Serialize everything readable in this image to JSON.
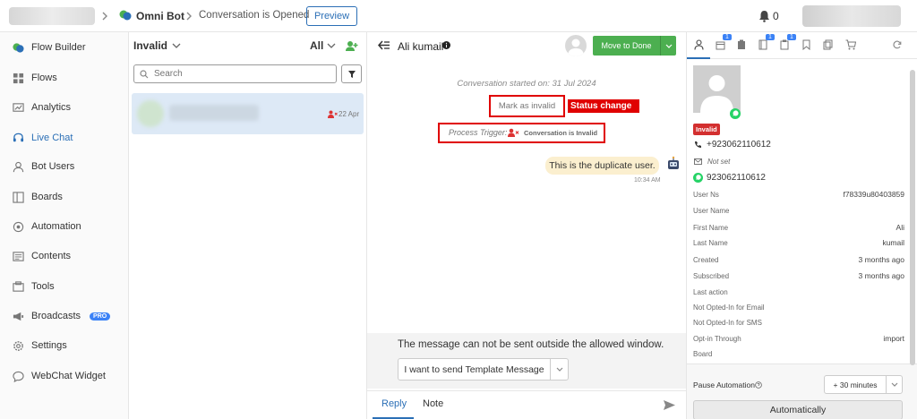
{
  "topbar": {
    "bot_name": "Omni Bot",
    "status": "Conversation is Opened",
    "preview_label": "Preview",
    "notification_count": "0"
  },
  "sidebar": {
    "items": [
      {
        "label": "Flow Builder",
        "icon": "chat-bubbles-icon"
      },
      {
        "label": "Flows",
        "icon": "grid-icon"
      },
      {
        "label": "Analytics",
        "icon": "analytics-icon"
      },
      {
        "label": "Live Chat",
        "icon": "headset-icon"
      },
      {
        "label": "Bot Users",
        "icon": "user-icon"
      },
      {
        "label": "Boards",
        "icon": "board-icon"
      },
      {
        "label": "Automation",
        "icon": "automation-icon"
      },
      {
        "label": "Contents",
        "icon": "contents-icon"
      },
      {
        "label": "Tools",
        "icon": "tools-icon"
      },
      {
        "label": "Broadcasts",
        "icon": "megaphone-icon",
        "badge": "PRO"
      },
      {
        "label": "Settings",
        "icon": "gear-icon"
      },
      {
        "label": "WebChat Widget",
        "icon": "chat-icon"
      }
    ],
    "active": "Live Chat"
  },
  "list": {
    "filter_label": "Invalid",
    "all_label": "All",
    "search_placeholder": "Search",
    "conversation": {
      "date": "22 Apr"
    }
  },
  "chat": {
    "contact_name": "Ali kumail",
    "move_button": "Move to Done",
    "started_text": "Conversation started on: 31 Jul 2024",
    "mark_invalid_label": "Mark as invalid",
    "status_change_label": "Status change",
    "process_trigger_label": "Process Trigger:",
    "process_trigger_value": "Conversation is Invalid",
    "message_text": "This is the duplicate user.",
    "message_time": "10:34 AM",
    "notice_text": "The message can not be sent outside the allowed window.",
    "template_button": "I want to send Template Message",
    "tabs": [
      "Reply",
      "Note"
    ]
  },
  "details": {
    "tab_badges": [
      "1",
      "1",
      "1"
    ],
    "status_badge": "Invalid",
    "phone": "+923062110612",
    "email": "Not set",
    "whatsapp": "923062110612",
    "fields": [
      {
        "label": "User Ns",
        "value": "f78339u80403859"
      },
      {
        "label": "User Name",
        "value": ""
      },
      {
        "label": "First Name",
        "value": "Ali"
      },
      {
        "label": "Last Name",
        "value": "kumail"
      },
      {
        "label": "Created",
        "value": "3 months ago"
      },
      {
        "label": "Subscribed",
        "value": "3 months ago"
      },
      {
        "label": "Last action",
        "value": ""
      },
      {
        "label": "Not Opted-In for Email",
        "value": ""
      },
      {
        "label": "Not Opted-In for SMS",
        "value": ""
      },
      {
        "label": "Opt-in Through",
        "value": "import"
      },
      {
        "label": "Board",
        "value": ""
      }
    ],
    "pause_label": "Pause Automation",
    "pause_value": "+ 30 minutes",
    "automatically_label": "Automatically"
  },
  "colors": {
    "accent_blue": "#2b6fb6",
    "green": "#4caf50",
    "red": "#e00000",
    "message_bubble": "#fbefcf"
  }
}
